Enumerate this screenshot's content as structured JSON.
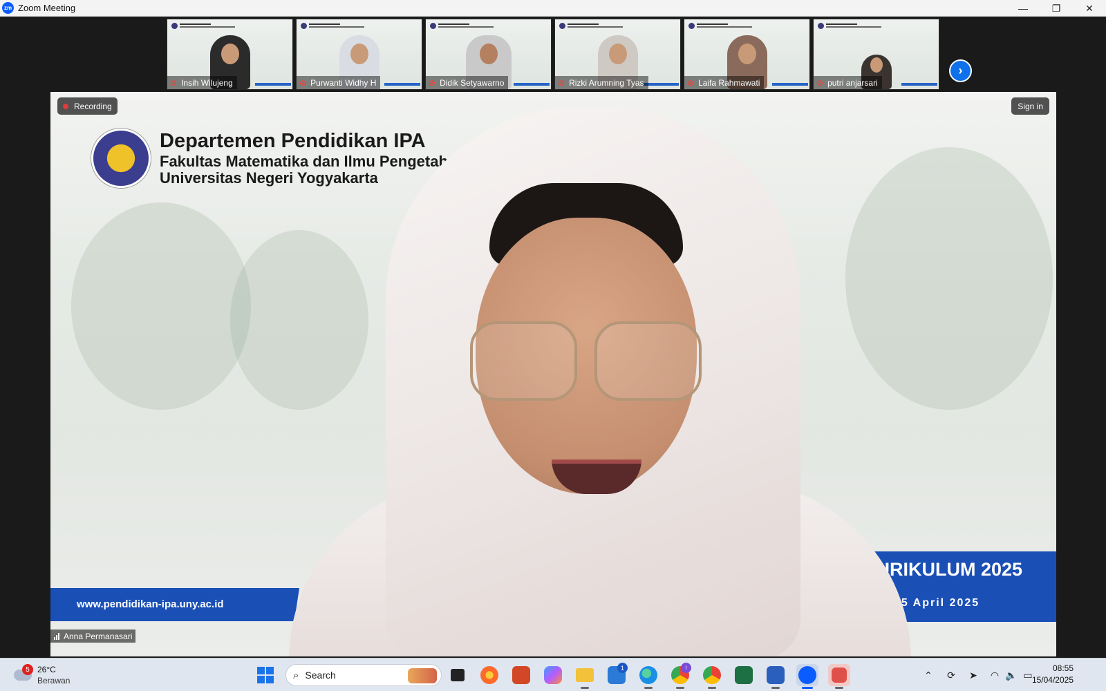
{
  "window": {
    "title": "Zoom Meeting",
    "app_icon_text": "zm",
    "controls": {
      "minimize": "—",
      "restore": "❐",
      "close": "✕"
    }
  },
  "participants": [
    {
      "name": "Insih Wilujeng",
      "muted": true
    },
    {
      "name": "Purwanti Widhy H",
      "muted": true
    },
    {
      "name": "Didik Setyawarno",
      "muted": true
    },
    {
      "name": "Rizki Arumning Tyas",
      "muted": true
    },
    {
      "name": "Laifa Rahmawati",
      "muted": true
    },
    {
      "name": "putri anjarsari",
      "muted": true
    }
  ],
  "thumbstrip": {
    "next_icon": "›"
  },
  "stage": {
    "recording_label": "Recording",
    "signin_label": "Sign in",
    "banner": {
      "line1": "Departemen Pendidikan IPA",
      "line2": "Fakultas Matematika dan Ilmu Pengetahu",
      "line3": "Universitas Negeri Yogyakarta"
    },
    "website": "www.pendidikan-ipa.uny.ac.id",
    "event_title": "KURIKULUM 2025",
    "event_date": "15 April 2025",
    "active_speaker": "Anna Permanasari"
  },
  "taskbar": {
    "weather": {
      "temperature": "26°C",
      "condition": "Berawan",
      "badge": "5"
    },
    "search_placeholder": "Search",
    "time": "08:55",
    "date": "15/04/2025",
    "store_badge": "1",
    "chrome_badge": "!"
  },
  "colors": {
    "zoom_blue": "#0e71eb",
    "banner_blue": "#1a4fb5",
    "recording_red": "#e03b3b",
    "muted_red": "#e8453c"
  }
}
